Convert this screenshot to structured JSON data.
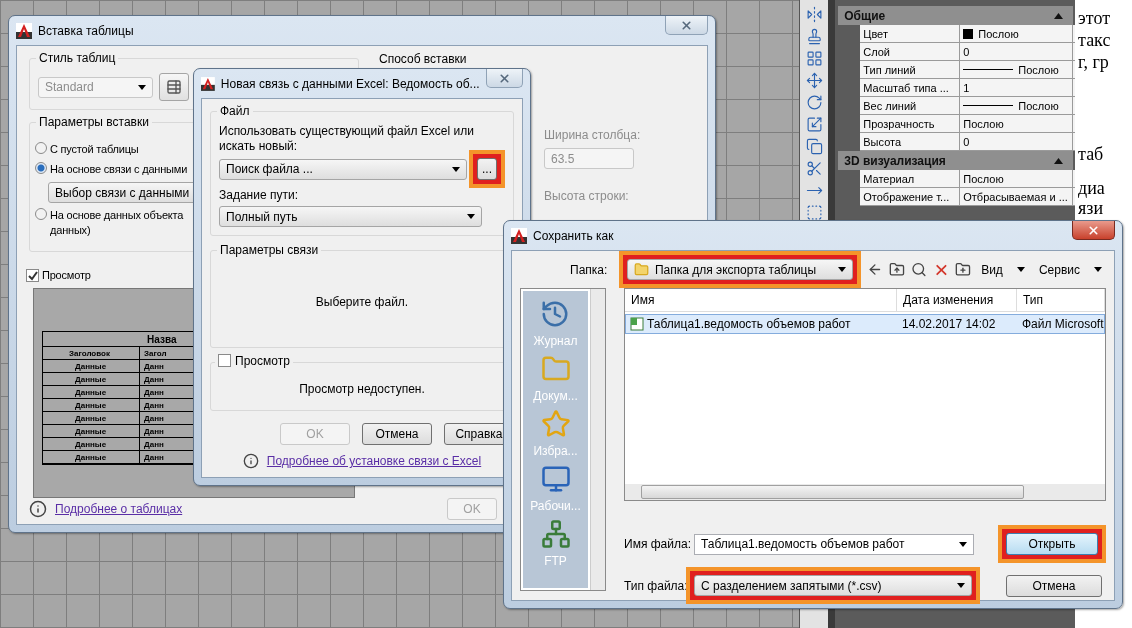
{
  "insert_table_window": {
    "title": "Вставка таблицы",
    "table_style": {
      "label": "Стиль таблиц",
      "value": "Standard",
      "disabled": true
    },
    "insert_method": {
      "label": "Способ вставки"
    },
    "insert_options": {
      "label": "Параметры вставки",
      "options": [
        {
          "label_lines": [
            "С пустой таблицы"
          ],
          "selected": false
        },
        {
          "label_lines": [
            "На основе связи с данными"
          ],
          "selected": true
        },
        {
          "label_lines": [
            "На основе данных объекта",
            "данных)"
          ],
          "selected": false
        }
      ],
      "data_link": "Выбор связи с данными"
    },
    "preview": {
      "label": "Просмотр",
      "checked": true
    },
    "preview_table": {
      "title": "Назва",
      "headers": [
        "Заголовок",
        "Загол"
      ],
      "rows": [
        [
          "Данные",
          "Данн"
        ],
        [
          "Данные",
          "Данн"
        ],
        [
          "Данные",
          "Данн"
        ],
        [
          "Данные",
          "Данн"
        ],
        [
          "Данные",
          "Данн"
        ],
        [
          "Данные",
          "Данн"
        ],
        [
          "Данные",
          "Данн"
        ],
        [
          "Данные",
          "Данн"
        ]
      ]
    },
    "column_width": {
      "label": "Ширина столбца:",
      "value": "63.5",
      "disabled": true
    },
    "row_height": {
      "label": "Высота строки:"
    },
    "help_link": "Подробнее о таблицах",
    "ok_button": {
      "label": "OK",
      "disabled": true
    }
  },
  "excel_link_dialog": {
    "title": "Новая связь с данными Excel: Ведомость об...",
    "file_group": {
      "label": "Файл",
      "hint": "Использовать существующий файл Excel или искать новый:",
      "file_select": "Поиск файла ...",
      "browse_button": {
        "label": "...",
        "highlighted": true
      },
      "path_label": "Задание пути:",
      "path_select": "Полный путь"
    },
    "link_params": {
      "label": "Параметры связи",
      "message": "Выберите файл."
    },
    "preview": {
      "label": "Просмотр",
      "checked": false,
      "message": "Просмотр недоступен."
    },
    "buttons": [
      {
        "label": "OK",
        "disabled": true
      },
      {
        "label": "Отмена",
        "disabled": false
      },
      {
        "label": "Справка",
        "disabled": false
      }
    ],
    "help_link": "Подробнее об установке связи с Excel"
  },
  "save_as_dialog": {
    "title": "Сохранить как",
    "folder": {
      "label": "Папка:",
      "value": "Папка для экспорта таблицы",
      "highlighted": true
    },
    "toolbar_menus": [
      "Вид",
      "Сервис"
    ],
    "places": [
      {
        "kind": "history",
        "label": "Журнал"
      },
      {
        "kind": "documents",
        "label": "Докум..."
      },
      {
        "kind": "favorites",
        "label": "Избра..."
      },
      {
        "kind": "desktop",
        "label": "Рабочи..."
      },
      {
        "kind": "ftp",
        "label": "FTP"
      }
    ],
    "columns": [
      "Имя",
      "Дата изменения",
      "Тип"
    ],
    "files": [
      {
        "name": "Таблица1.ведомость объемов работ",
        "date": "14.02.2017 14:02",
        "type": "Файл Microsoft",
        "selected": true
      }
    ],
    "file_name": {
      "label": "Имя файла:",
      "value": "Таблица1.ведомость объемов работ"
    },
    "file_type": {
      "label": "Тип файла:",
      "value": "С разделением запятыми (*.csv)",
      "highlighted": true
    },
    "open_button": {
      "label": "Открыть",
      "highlighted": true
    },
    "cancel_button": {
      "label": "Отмена"
    }
  },
  "properties_panel": {
    "sections": [
      {
        "title": "Общие",
        "expanded": true,
        "rows": [
          {
            "label": "Цвет",
            "value": "Послою",
            "kind": "swatch"
          },
          {
            "label": "Слой",
            "value": "0",
            "kind": "text"
          },
          {
            "label": "Тип линий",
            "value": "Послою",
            "kind": "line"
          },
          {
            "label": "Масштаб типа ...",
            "value": "1",
            "kind": "text"
          },
          {
            "label": "Вес линий",
            "value": "Послою",
            "kind": "line"
          },
          {
            "label": "Прозрачность",
            "value": "Послою",
            "kind": "text"
          },
          {
            "label": "Высота",
            "value": "0",
            "kind": "text"
          }
        ]
      },
      {
        "title": "3D визуализация",
        "expanded": true,
        "rows": [
          {
            "label": "Материал",
            "value": "Послою",
            "kind": "text"
          },
          {
            "label": "Отображение т...",
            "value": "Отбрасываемая и ...",
            "kind": "text"
          }
        ]
      }
    ]
  },
  "document_fragments": [
    "этот",
    "такс",
    "г, гр",
    "таб",
    "диа",
    "язи"
  ]
}
